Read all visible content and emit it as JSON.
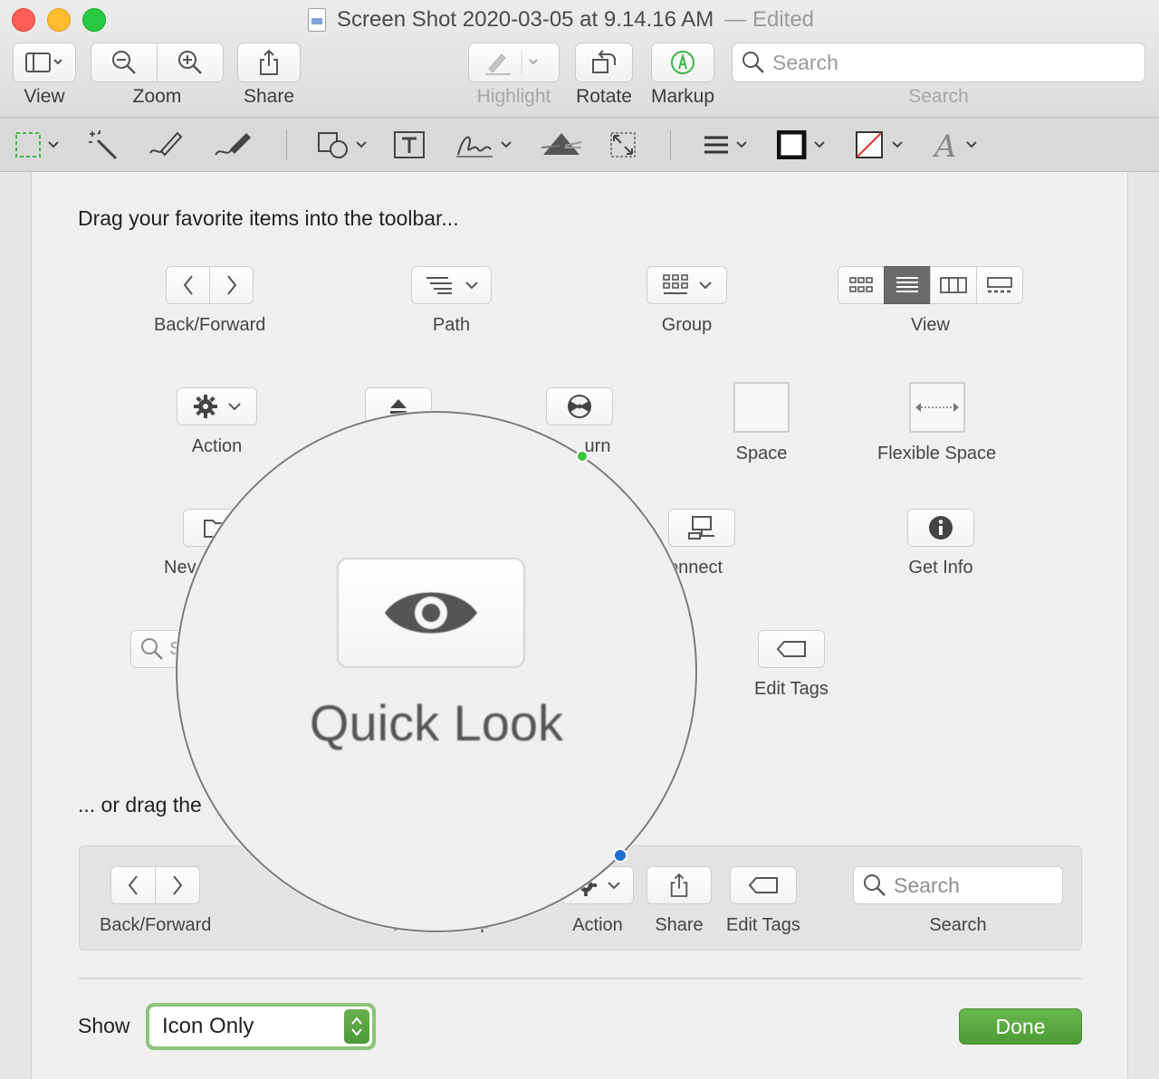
{
  "window": {
    "title": "Screen Shot 2020-03-05 at 9.14.16 AM",
    "edited": "— Edited"
  },
  "toolbar": {
    "view_label": "View",
    "zoom_label": "Zoom",
    "share_label": "Share",
    "highlight_label": "Highlight",
    "rotate_label": "Rotate",
    "markup_label": "Markup",
    "search_placeholder": "Search",
    "search_label": "Search"
  },
  "sheet": {
    "drag_heading": "Drag your favorite items into the toolbar...",
    "drag_default": "... or drag the",
    "items": {
      "back_forward": "Back/Forward",
      "path": "Path",
      "group": "Group",
      "view": "View",
      "action": "Action",
      "burn": "urn",
      "space": "Space",
      "flexible_space": "Flexible Space",
      "new": "Nev",
      "connect": "onnect",
      "get_info": "Get Info",
      "search_fragment": "S",
      "edit_tags": "Edit Tags"
    },
    "default_set": {
      "back_forward": "Back/Forward",
      "view": "View",
      "group": "oup",
      "action": "Action",
      "share": "Share",
      "edit_tags": "Edit Tags",
      "search_placeholder": "Search",
      "search_label": "Search"
    },
    "show_label": "Show",
    "show_value": "Icon Only",
    "done_label": "Done"
  },
  "magnifier": {
    "label": "Quick Look",
    "icon": "eye-icon"
  },
  "colors": {
    "accent_green": "#5aa843",
    "handle_blue": "#1f6fd0",
    "handle_green": "#37c63c"
  }
}
